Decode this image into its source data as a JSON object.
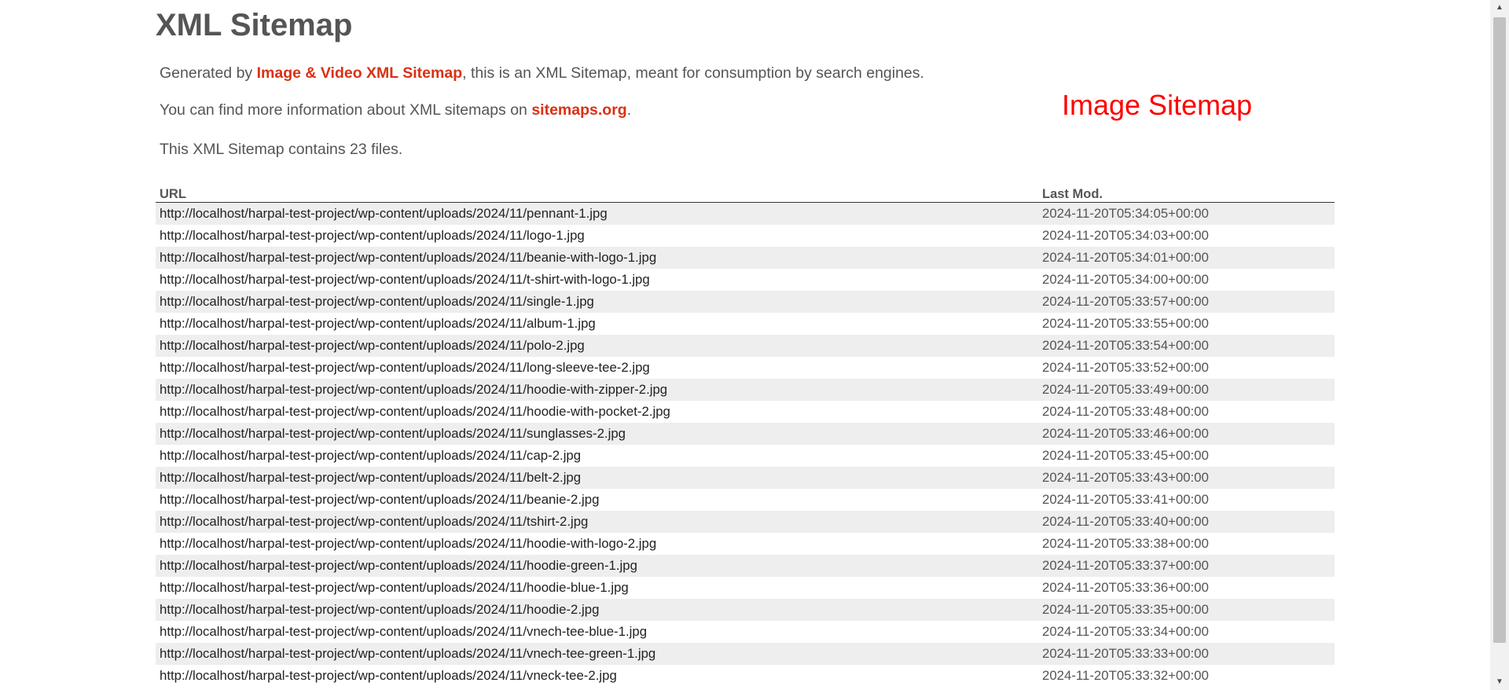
{
  "page": {
    "title": "XML Sitemap",
    "intro": {
      "generated_prefix": "Generated by ",
      "generator_link": "Image & Video XML Sitemap",
      "generated_suffix": ", this is an XML Sitemap, meant for consumption by search engines.",
      "info_prefix": "You can find more information about XML sitemaps on ",
      "info_link": "sitemaps.org",
      "info_suffix": ".",
      "count_text": "This XML Sitemap contains 23 files."
    },
    "sitemap_type": "Image Sitemap"
  },
  "table": {
    "headers": {
      "url": "URL",
      "lastmod": "Last Mod."
    },
    "rows": [
      {
        "url": "http://localhost/harpal-test-project/wp-content/uploads/2024/11/pennant-1.jpg",
        "lastmod": "2024-11-20T05:34:05+00:00"
      },
      {
        "url": "http://localhost/harpal-test-project/wp-content/uploads/2024/11/logo-1.jpg",
        "lastmod": "2024-11-20T05:34:03+00:00"
      },
      {
        "url": "http://localhost/harpal-test-project/wp-content/uploads/2024/11/beanie-with-logo-1.jpg",
        "lastmod": "2024-11-20T05:34:01+00:00"
      },
      {
        "url": "http://localhost/harpal-test-project/wp-content/uploads/2024/11/t-shirt-with-logo-1.jpg",
        "lastmod": "2024-11-20T05:34:00+00:00"
      },
      {
        "url": "http://localhost/harpal-test-project/wp-content/uploads/2024/11/single-1.jpg",
        "lastmod": "2024-11-20T05:33:57+00:00"
      },
      {
        "url": "http://localhost/harpal-test-project/wp-content/uploads/2024/11/album-1.jpg",
        "lastmod": "2024-11-20T05:33:55+00:00"
      },
      {
        "url": "http://localhost/harpal-test-project/wp-content/uploads/2024/11/polo-2.jpg",
        "lastmod": "2024-11-20T05:33:54+00:00"
      },
      {
        "url": "http://localhost/harpal-test-project/wp-content/uploads/2024/11/long-sleeve-tee-2.jpg",
        "lastmod": "2024-11-20T05:33:52+00:00"
      },
      {
        "url": "http://localhost/harpal-test-project/wp-content/uploads/2024/11/hoodie-with-zipper-2.jpg",
        "lastmod": "2024-11-20T05:33:49+00:00"
      },
      {
        "url": "http://localhost/harpal-test-project/wp-content/uploads/2024/11/hoodie-with-pocket-2.jpg",
        "lastmod": "2024-11-20T05:33:48+00:00"
      },
      {
        "url": "http://localhost/harpal-test-project/wp-content/uploads/2024/11/sunglasses-2.jpg",
        "lastmod": "2024-11-20T05:33:46+00:00"
      },
      {
        "url": "http://localhost/harpal-test-project/wp-content/uploads/2024/11/cap-2.jpg",
        "lastmod": "2024-11-20T05:33:45+00:00"
      },
      {
        "url": "http://localhost/harpal-test-project/wp-content/uploads/2024/11/belt-2.jpg",
        "lastmod": "2024-11-20T05:33:43+00:00"
      },
      {
        "url": "http://localhost/harpal-test-project/wp-content/uploads/2024/11/beanie-2.jpg",
        "lastmod": "2024-11-20T05:33:41+00:00"
      },
      {
        "url": "http://localhost/harpal-test-project/wp-content/uploads/2024/11/tshirt-2.jpg",
        "lastmod": "2024-11-20T05:33:40+00:00"
      },
      {
        "url": "http://localhost/harpal-test-project/wp-content/uploads/2024/11/hoodie-with-logo-2.jpg",
        "lastmod": "2024-11-20T05:33:38+00:00"
      },
      {
        "url": "http://localhost/harpal-test-project/wp-content/uploads/2024/11/hoodie-green-1.jpg",
        "lastmod": "2024-11-20T05:33:37+00:00"
      },
      {
        "url": "http://localhost/harpal-test-project/wp-content/uploads/2024/11/hoodie-blue-1.jpg",
        "lastmod": "2024-11-20T05:33:36+00:00"
      },
      {
        "url": "http://localhost/harpal-test-project/wp-content/uploads/2024/11/hoodie-2.jpg",
        "lastmod": "2024-11-20T05:33:35+00:00"
      },
      {
        "url": "http://localhost/harpal-test-project/wp-content/uploads/2024/11/vnech-tee-blue-1.jpg",
        "lastmod": "2024-11-20T05:33:34+00:00"
      },
      {
        "url": "http://localhost/harpal-test-project/wp-content/uploads/2024/11/vnech-tee-green-1.jpg",
        "lastmod": "2024-11-20T05:33:33+00:00"
      },
      {
        "url": "http://localhost/harpal-test-project/wp-content/uploads/2024/11/vneck-tee-2.jpg",
        "lastmod": "2024-11-20T05:33:32+00:00"
      }
    ]
  },
  "scrollbar": {
    "up_icon": "scroll-up-arrow-icon",
    "down_icon": "scroll-down-arrow-icon"
  },
  "colors": {
    "link": "#da3114",
    "sitemap_type": "#ff0000",
    "text": "#555555",
    "row_alt": "#eeeeee"
  }
}
